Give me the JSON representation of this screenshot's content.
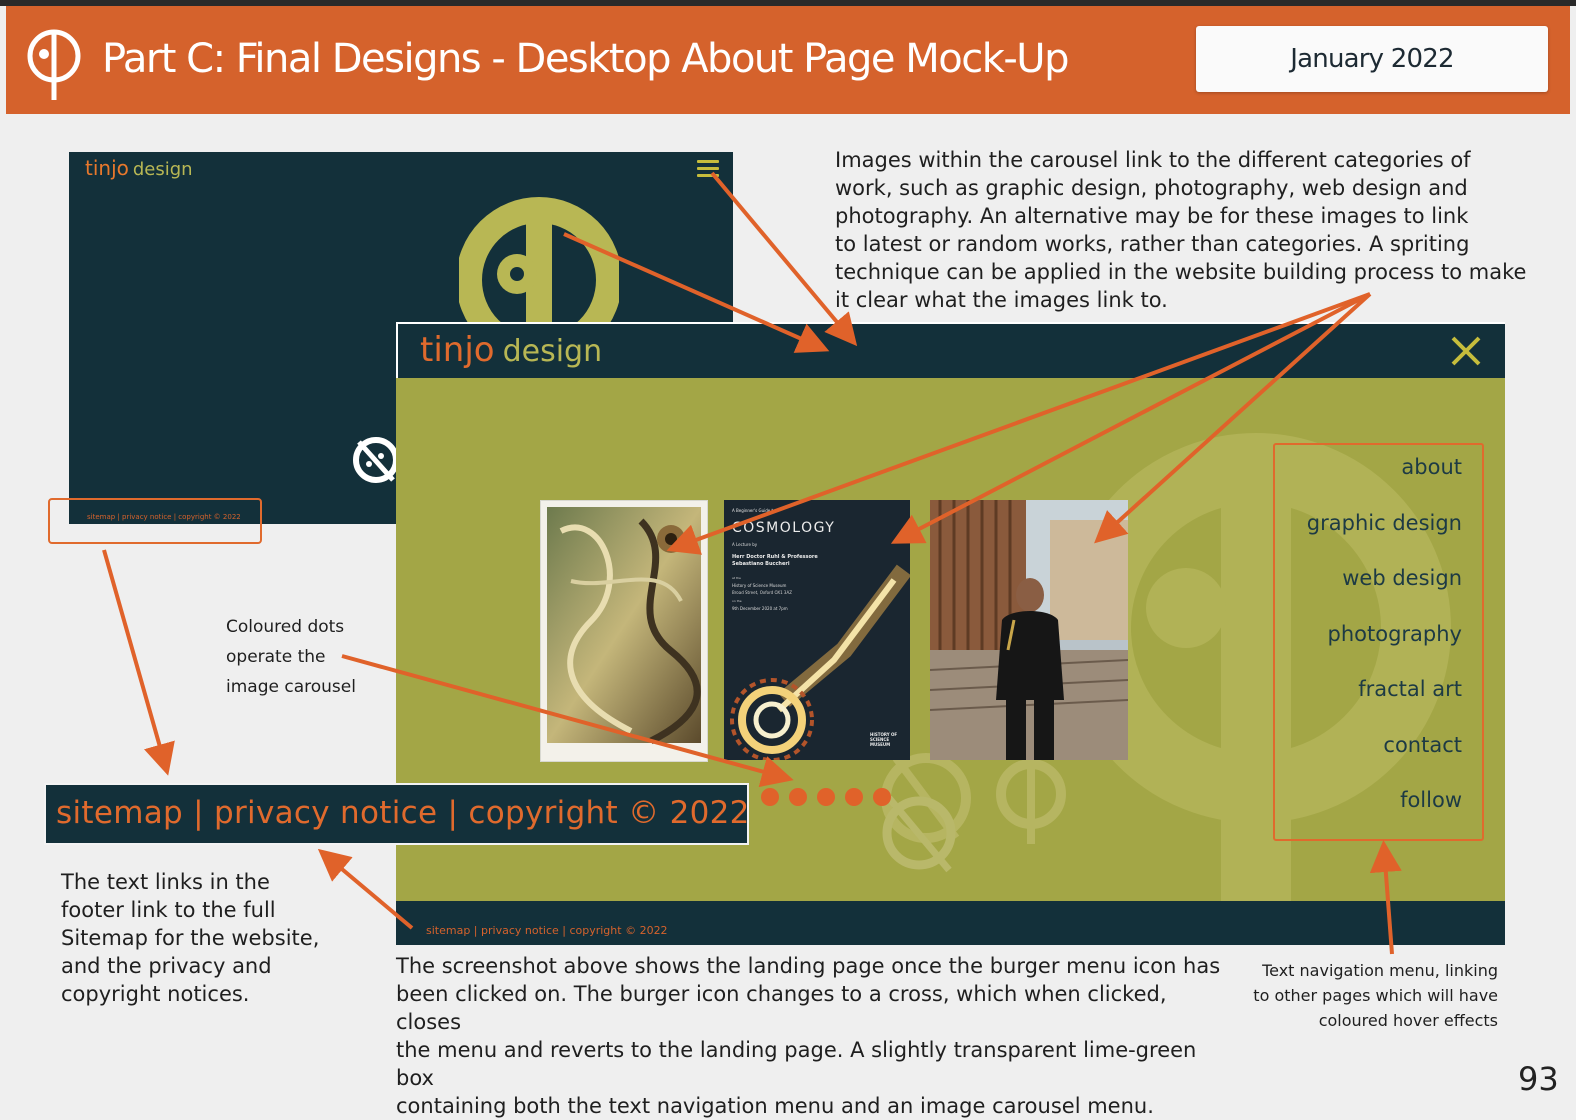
{
  "header": {
    "title": "Part C: Final Designs - Desktop About Page Mock-Up",
    "date": "January 2022"
  },
  "mockup_small": {
    "brand_tinjo": "tinjo",
    "brand_design": "design",
    "footer_text": "sitemap | privacy notice | copyright © 2022"
  },
  "mockup_large": {
    "brand_tinjo": "tinjo",
    "brand_design": "design",
    "nav_items": [
      "about",
      "graphic design",
      "web design",
      "photography",
      "fractal art",
      "contact",
      "follow"
    ],
    "cosmology_poster": {
      "kicker": "A Beginner's Guide to",
      "title": "COSMOLOGY",
      "sub": "A Lecture by",
      "speakers": "Herr Doctor Ruhl & Professore Sebastiano Buccheri",
      "venue_label": "at the",
      "venue": "History of Science Museum",
      "address": "Broad Street, Oxford OX1 3AZ",
      "on_label": "on the",
      "when": "9th December 2020 at 7pm",
      "museum_logo": "HISTORY OF SCIENCE MUSEUM"
    },
    "footer_text": "sitemap | privacy notice | copyright © 2022"
  },
  "footer_zoom": {
    "text": "sitemap | privacy notice | copyright © 2022"
  },
  "annotations": {
    "carousel": [
      "Images within the carousel link to the different categories of",
      "work, such as graphic design, photography, web design and",
      "photography. An alternative may be for these images to link",
      "to latest or random works, rather than categories. A spriting",
      "technique can be applied in the website building process to make",
      "it clear what the images link to."
    ],
    "dots": [
      "Coloured dots",
      "operate the",
      "image carousel"
    ],
    "footer_links": [
      "The text links in the",
      "footer link to the full",
      "Sitemap for the website,",
      "and the privacy and",
      "copyright notices."
    ],
    "screenshot": [
      "The screenshot above shows the landing page once the burger menu icon has",
      "been clicked on. The burger icon changes to a cross, which when clicked, closes",
      "the menu and reverts to the landing page. A slightly transparent lime-green box",
      "containing both the text navigation menu and an image carousel menu."
    ],
    "nav_menu": [
      "Text navigation menu, linking",
      "to other pages which will have",
      "coloured hover effects"
    ]
  },
  "page_number": "93",
  "colors": {
    "brand_orange": "#d5622c",
    "dark_teal": "#13303a",
    "lime": "#a3a646",
    "olive": "#b8b754"
  },
  "icons": [
    "tinjo-logo-icon",
    "burger-menu-icon",
    "close-icon",
    "arrow-icon"
  ]
}
